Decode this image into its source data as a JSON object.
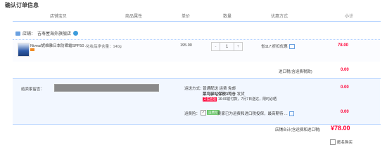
{
  "page_title": "确认订单信息",
  "columns": [
    "店铺宝贝",
    "商品属性",
    "单价",
    "数量",
    "优惠方式",
    "小计"
  ],
  "shop": {
    "label": "店铺：",
    "name": "吉寿屋海外旗舰店"
  },
  "item": {
    "name": "Nivea/妮维雅日本防晒霜SPF50 ...",
    "attribute": "化妆品净含量：140g",
    "unit_price": "195.00",
    "quantity_minus": "-",
    "quantity": "1",
    "quantity_plus": "+",
    "promotion": "省117:折扣优惠",
    "subtotal": "78.00"
  },
  "import_tax": {
    "label": "进口税(含运费税款)",
    "value": "0.00"
  },
  "message": {
    "label": "给卖家留言："
  },
  "shipping": {
    "label": "运送方式：",
    "method": "普通配送 运费 免邮",
    "carrier": "菜鸟驿站保税3司仓",
    "carrier_suffix": "发货",
    "tmall_tag": "天猫直送",
    "delivery_note": "16:00前付款，7月7日送达，限时必晒",
    "value": "0.00"
  },
  "insurance": {
    "label": "运费险：",
    "check": "✓",
    "tag": "运费险",
    "text": "卖家已为运费和进口税投保，最高期待 ...",
    "value": "0.00"
  },
  "total": {
    "label": "店铺合计(含运费和进口税)",
    "value": "¥78.00"
  },
  "footer": {
    "label": "匿名购买"
  }
}
